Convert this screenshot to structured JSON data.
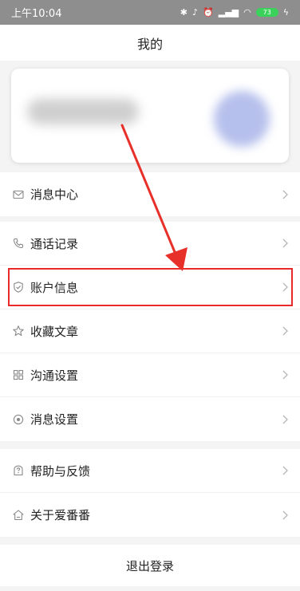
{
  "status_bar": {
    "time": "上午10:04",
    "battery": "73",
    "icons": [
      "bluetooth-icon",
      "mute-icon",
      "alarm-icon",
      "signal-icon",
      "wifi-icon",
      "battery-icon",
      "charging-icon"
    ]
  },
  "nav": {
    "title": "我的"
  },
  "menu": {
    "group1": [
      {
        "label": "消息中心",
        "icon": "mail-icon"
      }
    ],
    "group2": [
      {
        "label": "通话记录",
        "icon": "phone-icon"
      },
      {
        "label": "账户信息",
        "icon": "shield-icon",
        "highlighted": true
      },
      {
        "label": "收藏文章",
        "icon": "star-icon"
      },
      {
        "label": "沟通设置",
        "icon": "grid-icon"
      },
      {
        "label": "消息设置",
        "icon": "target-icon"
      }
    ],
    "group3": [
      {
        "label": "帮助与反馈",
        "icon": "help-icon"
      },
      {
        "label": "关于爱番番",
        "icon": "about-icon"
      }
    ]
  },
  "logout": {
    "label": "退出登录"
  },
  "colors": {
    "highlight": "#e82a2a",
    "arrow": "#e8302a",
    "status_bar": "#8e8e8e",
    "battery": "#3ad25a"
  }
}
